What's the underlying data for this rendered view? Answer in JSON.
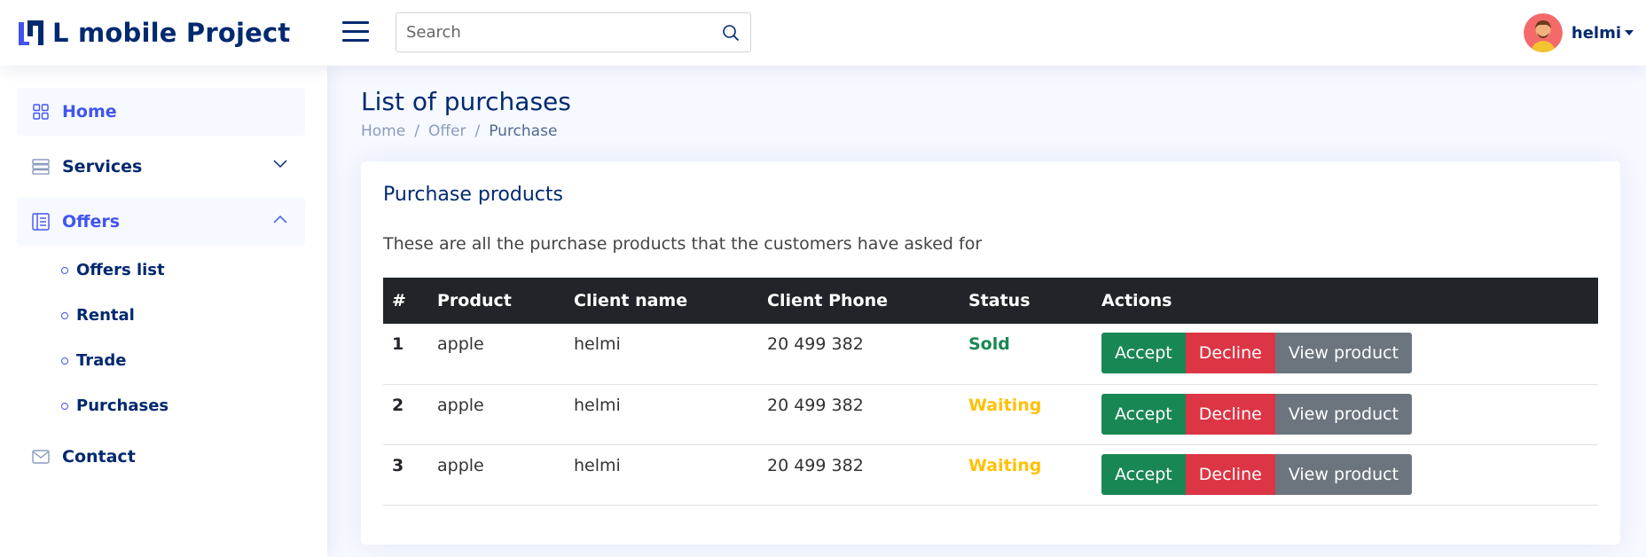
{
  "header": {
    "app_title": "L mobile Project",
    "search_placeholder": "Search",
    "user_name": "helmi"
  },
  "sidebar": {
    "items": [
      {
        "label": "Home",
        "icon": "grid-icon"
      },
      {
        "label": "Services",
        "icon": "server-icon"
      },
      {
        "label": "Offers",
        "icon": "layout-icon"
      },
      {
        "label": "Contact",
        "icon": "envelope-icon"
      }
    ],
    "offers_sub": [
      "Offers list",
      "Rental",
      "Trade",
      "Purchases"
    ]
  },
  "page": {
    "title": "List of purchases",
    "breadcrumb": [
      "Home",
      "Offer",
      "Purchase"
    ]
  },
  "card": {
    "title": "Purchase products",
    "description": "These are all the purchase products that the customers have asked for",
    "columns": [
      "#",
      "Product",
      "Client name",
      "Client Phone",
      "Status",
      "Actions"
    ],
    "rows": [
      {
        "num": "1",
        "product": "apple",
        "client": "helmi",
        "phone": "20 499 382",
        "status": "Sold"
      },
      {
        "num": "2",
        "product": "apple",
        "client": "helmi",
        "phone": "20 499 382",
        "status": "Waiting"
      },
      {
        "num": "3",
        "product": "apple",
        "client": "helmi",
        "phone": "20 499 382",
        "status": "Waiting"
      }
    ],
    "actions": {
      "accept": "Accept",
      "decline": "Decline",
      "view": "View product"
    }
  },
  "colors": {
    "brand": "#012970",
    "accent": "#4154f1",
    "sold": "#198754",
    "waiting": "#ffc107",
    "decline": "#dc3545",
    "view": "#6c757d"
  }
}
